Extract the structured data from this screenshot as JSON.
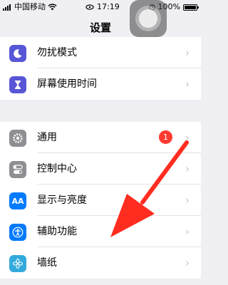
{
  "status_bar": {
    "carrier": "中国移动",
    "time": "17:19",
    "battery": "100%"
  },
  "nav": {
    "title": "设置"
  },
  "group1": [
    {
      "label": "勿扰模式",
      "icon": "moon-icon",
      "color": "#5856d6"
    },
    {
      "label": "屏幕使用时间",
      "icon": "hourglass-icon",
      "color": "#5856d6"
    }
  ],
  "group2": [
    {
      "label": "通用",
      "icon": "gear-icon",
      "color": "#8e8e93",
      "badge": "1"
    },
    {
      "label": "控制中心",
      "icon": "toggles-icon",
      "color": "#8e8e93"
    },
    {
      "label": "显示与亮度",
      "icon": "text-size-icon",
      "color": "#007aff",
      "glyph": "AA"
    },
    {
      "label": "辅助功能",
      "icon": "accessibility-icon",
      "color": "#007aff"
    },
    {
      "label": "墙纸",
      "icon": "flower-icon",
      "color": "#34aadc"
    }
  ],
  "colors": {
    "arrow": "#ff2d20",
    "badge": "#ff3b30",
    "background": "#efeff4"
  }
}
